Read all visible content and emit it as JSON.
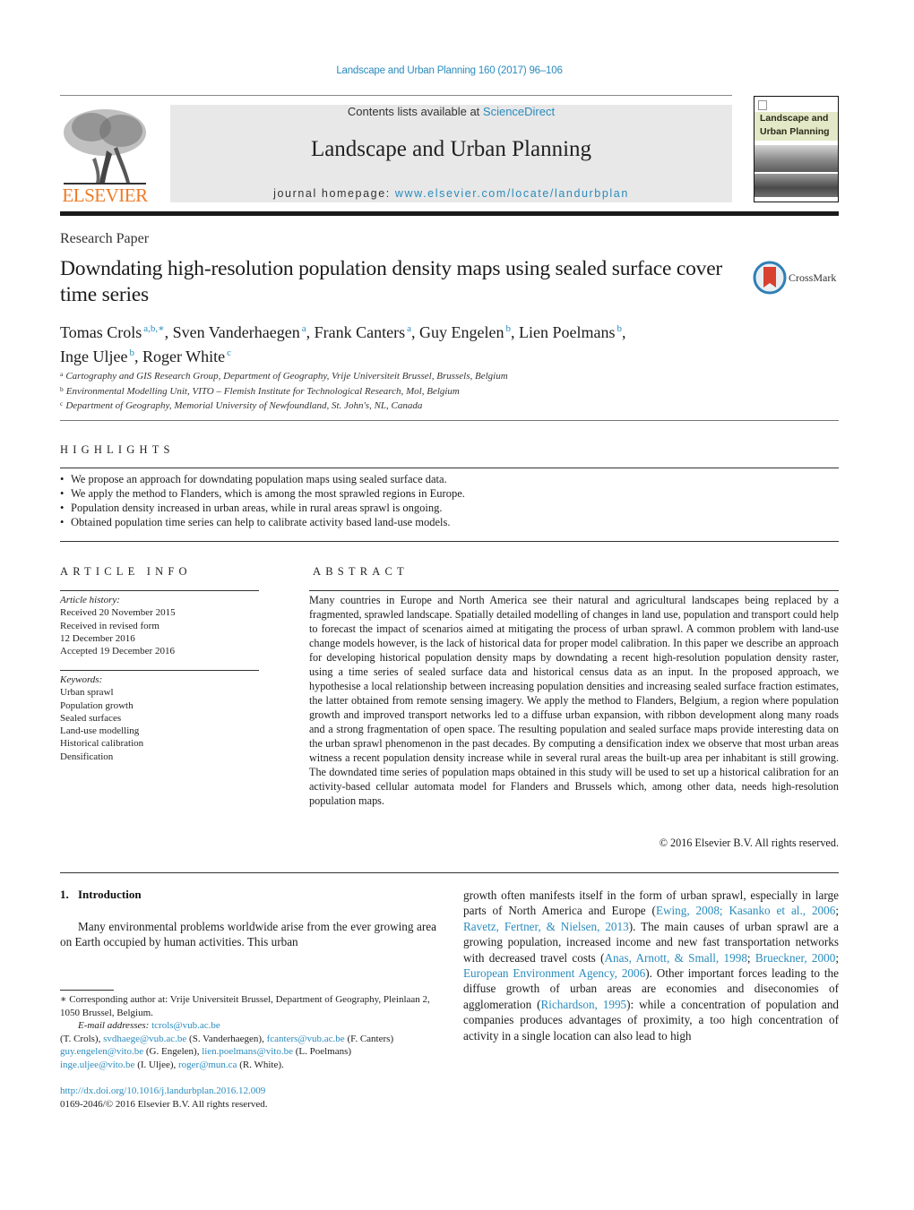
{
  "citation": "Landscape and Urban Planning 160 (2017) 96–106",
  "masthead": {
    "contents_prefix": "Contents lists available at ",
    "contents_link": "ScienceDirect",
    "journal_name": "Landscape and Urban Planning",
    "homepage_prefix": "journal homepage: ",
    "homepage_link": "www.elsevier.com/locate/landurbplan",
    "publisher_logo_text": "ELSEVIER",
    "cover_title_line1": "Landscape and",
    "cover_title_line2": "Urban Planning"
  },
  "article": {
    "type": "Research Paper",
    "title": "Downdating high-resolution population density maps using sealed surface cover time series",
    "crossmark_label": "CrossMark",
    "authors": [
      {
        "name": "Tomas Crols",
        "aff": "a,b,∗",
        "sep": ", "
      },
      {
        "name": "Sven Vanderhaegen",
        "aff": "a",
        "sep": ", "
      },
      {
        "name": "Frank Canters",
        "aff": "a",
        "sep": ", "
      },
      {
        "name": "Guy Engelen",
        "aff": "b",
        "sep": ", "
      },
      {
        "name": "Lien Poelmans",
        "aff": "b",
        "sep": ","
      },
      {
        "name": "Inge Uljee",
        "aff": "b",
        "sep": ", "
      },
      {
        "name": "Roger White",
        "aff": "c",
        "sep": ""
      }
    ],
    "affiliations": [
      {
        "key": "a",
        "text": "Cartography and GIS Research Group, Department of Geography, Vrije Universiteit Brussel, Brussels, Belgium"
      },
      {
        "key": "b",
        "text": "Environmental Modelling Unit, VITO – Flemish Institute for Technological Research, Mol, Belgium"
      },
      {
        "key": "c",
        "text": "Department of Geography, Memorial University of Newfoundland, St. John's, NL, Canada"
      }
    ]
  },
  "highlights": {
    "heading": "HIGHLIGHTS",
    "bullet": "•",
    "items": [
      "We propose an approach for downdating population maps using sealed surface data.",
      "We apply the method to Flanders, which is among the most sprawled regions in Europe.",
      "Population density increased in urban areas, while in rural areas sprawl is ongoing.",
      "Obtained population time series can help to calibrate activity based land-use models."
    ]
  },
  "article_info": {
    "heading": "ARTICLE INFO",
    "history_label": "Article history:",
    "history": [
      "Received 20 November 2015",
      "Received in revised form",
      "12 December 2016",
      "Accepted 19 December 2016"
    ],
    "keywords_label": "Keywords:",
    "keywords": [
      "Urban sprawl",
      "Population growth",
      "Sealed surfaces",
      "Land-use modelling",
      "Historical calibration",
      "Densification"
    ]
  },
  "abstract": {
    "heading": "ABSTRACT",
    "text": "Many countries in Europe and North America see their natural and agricultural landscapes being replaced by a fragmented, sprawled landscape. Spatially detailed modelling of changes in land use, population and transport could help to forecast the impact of scenarios aimed at mitigating the process of urban sprawl. A common problem with land-use change models however, is the lack of historical data for proper model calibration. In this paper we describe an approach for developing historical population density maps by downdating a recent high-resolution population density raster, using a time series of sealed surface data and historical census data as an input. In the proposed approach, we hypothesise a local relationship between increasing population densities and increasing sealed surface fraction estimates, the latter obtained from remote sensing imagery. We apply the method to Flanders, Belgium, a region where population growth and improved transport networks led to a diffuse urban expansion, with ribbon development along many roads and a strong fragmentation of open space. The resulting population and sealed surface maps provide interesting data on the urban sprawl phenomenon in the past decades. By computing a densification index we observe that most urban areas witness a recent population density increase while in several rural areas the built-up area per inhabitant is still growing. The downdated time series of population maps obtained in this study will be used to set up a historical calibration for an activity-based cellular automata model for Flanders and Brussels which, among other data, needs high-resolution population maps.",
    "copyright": "© 2016 Elsevier B.V. All rights reserved."
  },
  "body": {
    "section_number": "1.",
    "section_title": "Introduction",
    "left_paragraph": "Many environmental problems worldwide arise from the ever growing area on Earth occupied by human activities. This urban",
    "right_segments": [
      {
        "t": "growth often manifests itself in the form of urban sprawl, especially in large parts of North America and Europe (",
        "link": false
      },
      {
        "t": "Ewing, 2008; Kasanko et al., 2006",
        "link": true
      },
      {
        "t": "; ",
        "link": false
      },
      {
        "t": "Ravetz, Fertner, & Nielsen, 2013",
        "link": true
      },
      {
        "t": "). The main causes of urban sprawl are a growing population, increased income and new fast transportation networks with decreased travel costs (",
        "link": false
      },
      {
        "t": "Anas, Arnott, & Small, 1998",
        "link": true
      },
      {
        "t": "; ",
        "link": false
      },
      {
        "t": "Brueckner, 2000",
        "link": true
      },
      {
        "t": "; ",
        "link": false
      },
      {
        "t": "European Environment Agency, 2006",
        "link": true
      },
      {
        "t": "). Other important forces leading to the diffuse growth of urban areas are economies and diseconomies of agglomeration (",
        "link": false
      },
      {
        "t": "Richardson, 1995",
        "link": true
      },
      {
        "t": "): while a concentration of population and companies produces advantages of proximity, a too high concentration of activity in a single location can also lead to high",
        "link": false
      }
    ]
  },
  "footnotes": {
    "corresponding": "∗ Corresponding author at: Vrije Universiteit Brussel, Department of Geography, Pleinlaan 2, 1050 Brussel, Belgium.",
    "email_label": "E-mail addresses:",
    "emails": [
      {
        "email": "tcrols@vub.ac.be",
        "who": "(T. Crols)"
      },
      {
        "email": "svdhaege@vub.ac.be",
        "who": "(S. Vanderhaegen)"
      },
      {
        "email": "fcanters@vub.ac.be",
        "who": "(F. Canters)"
      },
      {
        "email": "guy.engelen@vito.be",
        "who": "(G. Engelen)"
      },
      {
        "email": "lien.poelmans@vito.be",
        "who": "(L. Poelmans)"
      },
      {
        "email": "inge.uljee@vito.be",
        "who": "(I. Uljee)"
      },
      {
        "email": "roger@mun.ca",
        "who": "(R. White)."
      }
    ],
    "doi": "http://dx.doi.org/10.1016/j.landurbplan.2016.12.009",
    "issn_copyright": "0169-2046/© 2016 Elsevier B.V. All rights reserved."
  },
  "colors": {
    "link": "#2a8bbd",
    "elsevier_orange": "#f07a24",
    "banner_gray": "#e8e8e8",
    "crossmark_red": "#d8412f",
    "crossmark_ring": "#2f7fb5"
  }
}
